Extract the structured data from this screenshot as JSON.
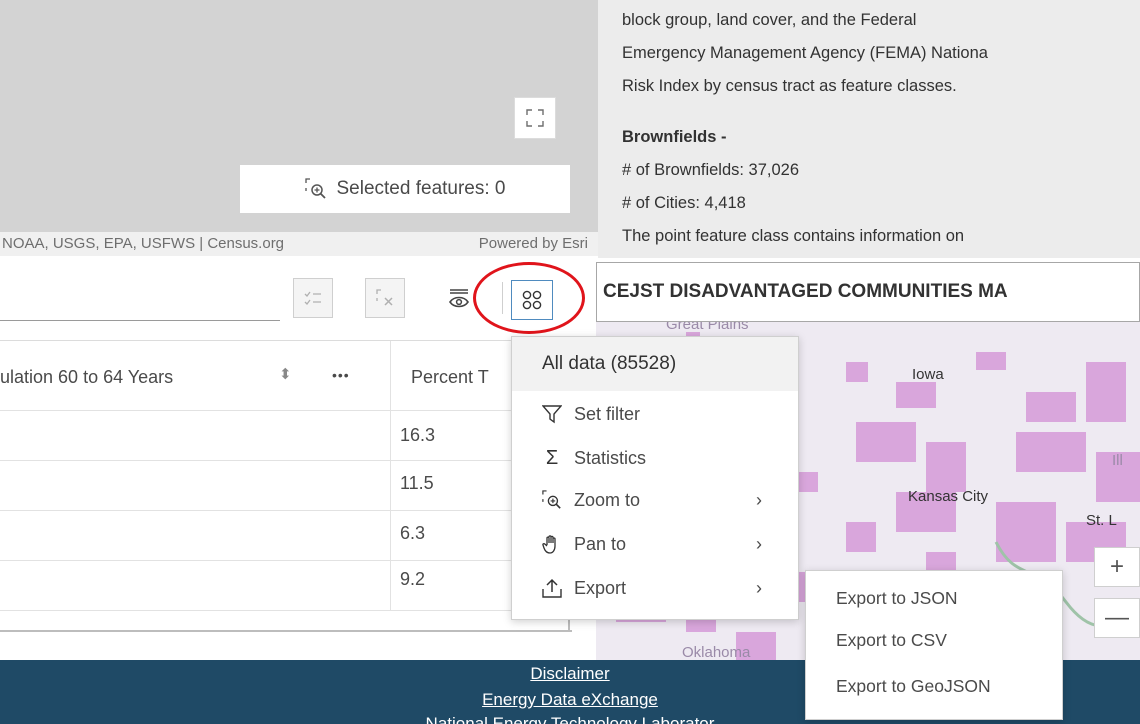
{
  "map_view": {
    "selected_features": "Selected features: 0",
    "attribution": "NOAA, USGS, EPA, USFWS | Census.org",
    "powered_by": "Powered by Esri"
  },
  "description": {
    "lines": [
      "block group, land cover, and the Federal",
      "Emergency Management Agency (FEMA) Nationa",
      "Risk Index by census tract as feature classes."
    ],
    "heading": "Brownfields -",
    "stats": [
      "# of Brownfields:  37,026",
      "# of Cities:  4,418"
    ],
    "trailing": "The point feature class contains information on"
  },
  "table": {
    "columns": [
      {
        "label": "ulation 60 to 64 Years"
      },
      {
        "label": "Percent T"
      }
    ],
    "sort_glyph": "⬍",
    "more_glyph": "•••",
    "rows": [
      {
        "value": "16.3"
      },
      {
        "value": "11.5"
      },
      {
        "value": "6.3"
      },
      {
        "value": "9.2"
      }
    ]
  },
  "menu": {
    "header": "All data (85528)",
    "items": [
      {
        "label": "Set filter",
        "icon": "filter-icon"
      },
      {
        "label": "Statistics",
        "icon": "sigma-icon"
      },
      {
        "label": "Zoom to",
        "icon": "zoom-to-icon",
        "chevron": "›"
      },
      {
        "label": "Pan to",
        "icon": "hand-icon",
        "chevron": "›"
      },
      {
        "label": "Export",
        "icon": "export-icon",
        "chevron": "›"
      }
    ]
  },
  "submenu": {
    "items": [
      "Export to JSON",
      "Export to CSV",
      "Export to GeoJSON"
    ]
  },
  "map_panel": {
    "title": "CEJST DISADVANTAGED COMMUNITIES MA",
    "labels": [
      "Great Plains",
      "Iowa",
      "Kansas City",
      "St. L",
      "Ill",
      "Oklahoma"
    ],
    "zoom_in": "+",
    "zoom_out": "—"
  },
  "footer": {
    "links": [
      "Disclaimer",
      "Energy Data eXchange",
      "National Energy Technology Laborator"
    ]
  },
  "colors": {
    "accent": "#4f8bbf",
    "highlight_circle": "#e0141b",
    "footer_bg": "#1f4a66",
    "map_patch": "#d9a6dc"
  }
}
